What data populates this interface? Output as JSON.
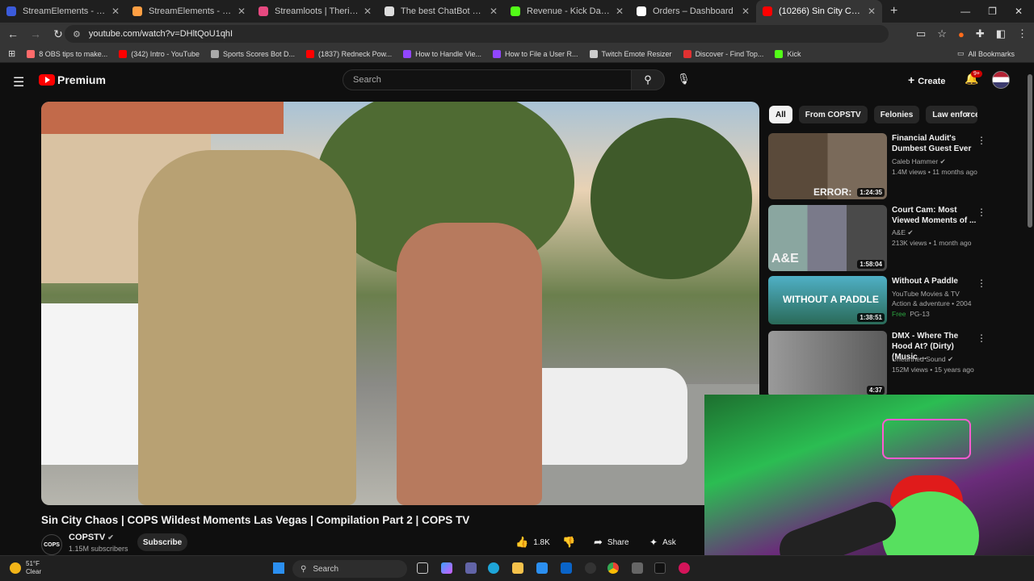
{
  "browser": {
    "tabs": [
      {
        "title": "StreamElements - Overlays",
        "color": "#3b5bdb"
      },
      {
        "title": "StreamElements - rippedredneck",
        "color": "#ff9f43"
      },
      {
        "title": "Streamloots | Therippedredneck",
        "color": "#e64980"
      },
      {
        "title": "The best ChatBot and Widgets",
        "color": "#dddddd"
      },
      {
        "title": "Revenue - Kick Dashboard",
        "color": "#53fc18"
      },
      {
        "title": "Orders – Dashboard",
        "color": "#ffffff"
      },
      {
        "title": "(10266) Sin City Chaos | COPS",
        "color": "#ff0000",
        "active": true
      }
    ],
    "url": "youtube.com/watch?v=DHltQoU1qhI",
    "bookmarks": [
      {
        "label": "8 OBS tips to make...",
        "color": "#ff6b6b"
      },
      {
        "label": "(342) Intro - YouTube",
        "color": "#ff0000"
      },
      {
        "label": "Sports Scores Bot D...",
        "color": "#aaaaaa"
      },
      {
        "label": "(1837) Redneck Pow...",
        "color": "#ff0000"
      },
      {
        "label": "How to Handle Vie...",
        "color": "#9146ff"
      },
      {
        "label": "How to File a User R...",
        "color": "#9146ff"
      },
      {
        "label": "Twitch Emote Resizer",
        "color": "#cccccc"
      },
      {
        "label": "Discover - Find Top...",
        "color": "#e03131"
      },
      {
        "label": "Kick",
        "color": "#53fc18"
      }
    ],
    "all_bookmarks": "All Bookmarks"
  },
  "youtube": {
    "logo_text": "Premium",
    "search_placeholder": "Search",
    "create_label": "Create",
    "notif_count": "9+",
    "video_title": "Sin City Chaos | COPS Wildest Moments Las Vegas | Compilation Part 2 | COPS TV",
    "channel": {
      "name": "COPSTV",
      "subs": "1.15M subscribers",
      "avatar_text": "COPS"
    },
    "subscribe_label": "Subscribe",
    "actions": {
      "likes": "1.8K",
      "share": "Share",
      "ask": "Ask"
    },
    "chips": [
      "All",
      "From COPSTV",
      "Felonies",
      "Law enforcem"
    ],
    "recommendations": [
      {
        "title": "Financial Audit's Dumbest Guest Ever",
        "channel": "Caleb Hammer",
        "meta": "1.4M views • 11 months ago",
        "duration": "1:24:35",
        "thumb_text": "ERROR:"
      },
      {
        "title": "Court Cam: Most Viewed Moments of ...",
        "channel": "A&E",
        "meta": "213K views • 1 month ago",
        "duration": "1:58:04",
        "thumb_text": "A&E"
      },
      {
        "title": "Without A Paddle",
        "channel": "YouTube Movies & TV",
        "meta": "Action & adventure • 2004",
        "duration": "1:38:51",
        "free": "Free",
        "rating": "PG-13",
        "thumb_text": "WITHOUT A PADDLE"
      },
      {
        "title": "DMX - Where The Hood At? (Dirty) (Music ...",
        "channel": "Unearthed Sound",
        "meta": "152M views • 15 years ago",
        "duration": "4:37"
      }
    ]
  },
  "taskbar": {
    "temp": "51°F",
    "condition": "Clear",
    "search": "Search"
  }
}
